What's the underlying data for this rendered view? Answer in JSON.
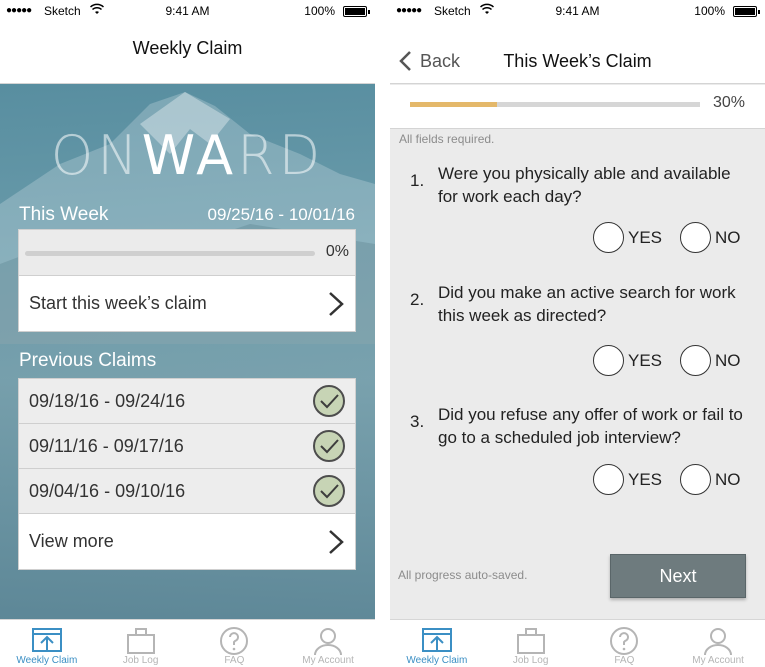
{
  "status_bar": {
    "carrier": "Sketch",
    "time": "9:41 AM",
    "battery": "100%"
  },
  "left_screen": {
    "nav_title": "Weekly Claim",
    "logo": {
      "prefix": "ON",
      "highlight": "WA",
      "suffix": "RD"
    },
    "this_week": {
      "label": "This Week",
      "date_range": "09/25/16 - 10/01/16",
      "progress_value": 0,
      "progress_text": "0%",
      "start_label": "Start this week’s claim"
    },
    "previous": {
      "label": "Previous Claims",
      "claims": [
        {
          "range": "09/18/16 - 09/24/16",
          "status": "complete"
        },
        {
          "range": "09/11/16 - 09/17/16",
          "status": "complete"
        },
        {
          "range": "09/04/16 - 09/10/16",
          "status": "complete"
        }
      ],
      "view_more": "View more"
    }
  },
  "right_screen": {
    "back_label": "Back",
    "nav_title": "This Week’s Claim",
    "progress_value": 0.3,
    "progress_text": "30%",
    "required_note": "All fields required.",
    "questions": [
      {
        "number": "1.",
        "text": "Were you physically able and available for work each day?"
      },
      {
        "number": "2.",
        "text": "Did you make an active search for work this week as directed?"
      },
      {
        "number": "3.",
        "text": "Did you refuse any offer of work or fail to go to a scheduled job interview?"
      }
    ],
    "yes_label": "YES",
    "no_label": "NO",
    "autosave_note": "All progress auto-saved.",
    "next_label": "Next"
  },
  "tab_bar": [
    {
      "label": "Weekly Claim",
      "icon": "weekly-claim-icon",
      "active": true
    },
    {
      "label": "Job Log",
      "icon": "briefcase-icon",
      "active": false
    },
    {
      "label": "FAQ",
      "icon": "question-icon",
      "active": false
    },
    {
      "label": "My Account",
      "icon": "person-icon",
      "active": false
    }
  ],
  "colors": {
    "accent": "#3b8fc4",
    "progress_fill": "#e4b86a",
    "button": "#6e7b7e",
    "hero": "#6e9fb0",
    "check": "#c7d4b5"
  }
}
